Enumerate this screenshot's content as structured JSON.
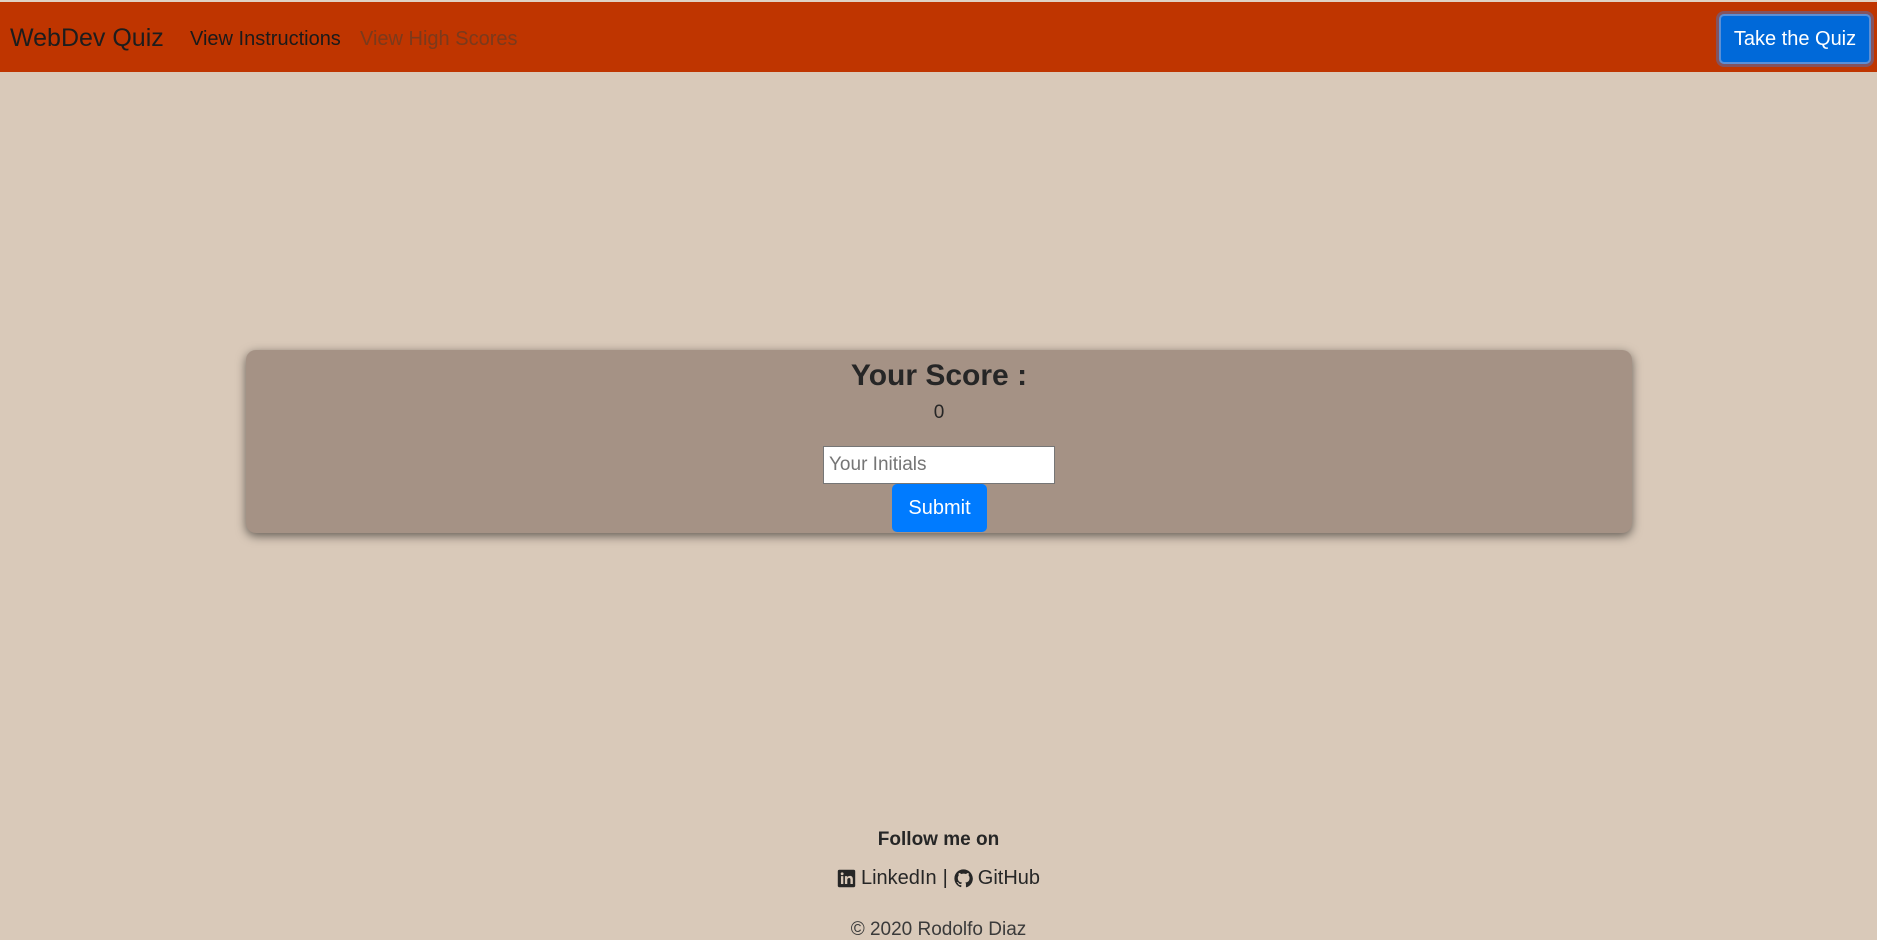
{
  "navbar": {
    "brand": "WebDev Quiz",
    "links": [
      {
        "label": "View Instructions"
      },
      {
        "label": "View High Scores"
      }
    ],
    "cta_label": "Take the Quiz"
  },
  "score_card": {
    "title": "Your Score :",
    "score": "0",
    "initials_placeholder": "Your Initials",
    "initials_value": "",
    "submit_label": "Submit"
  },
  "footer": {
    "follow_text": "Follow me on",
    "linkedin_label": "LinkedIn",
    "separator": "|",
    "github_label": "GitHub",
    "copyright": "© 2020 Rodolfo Diaz"
  },
  "colors": {
    "page_background": "#d9c9b9",
    "navbar": "#bf3500",
    "card": "#a59285",
    "primary_button": "#007bff",
    "cta_button": "#0069d9"
  },
  "icons": [
    "linkedin-icon",
    "github-icon"
  ]
}
